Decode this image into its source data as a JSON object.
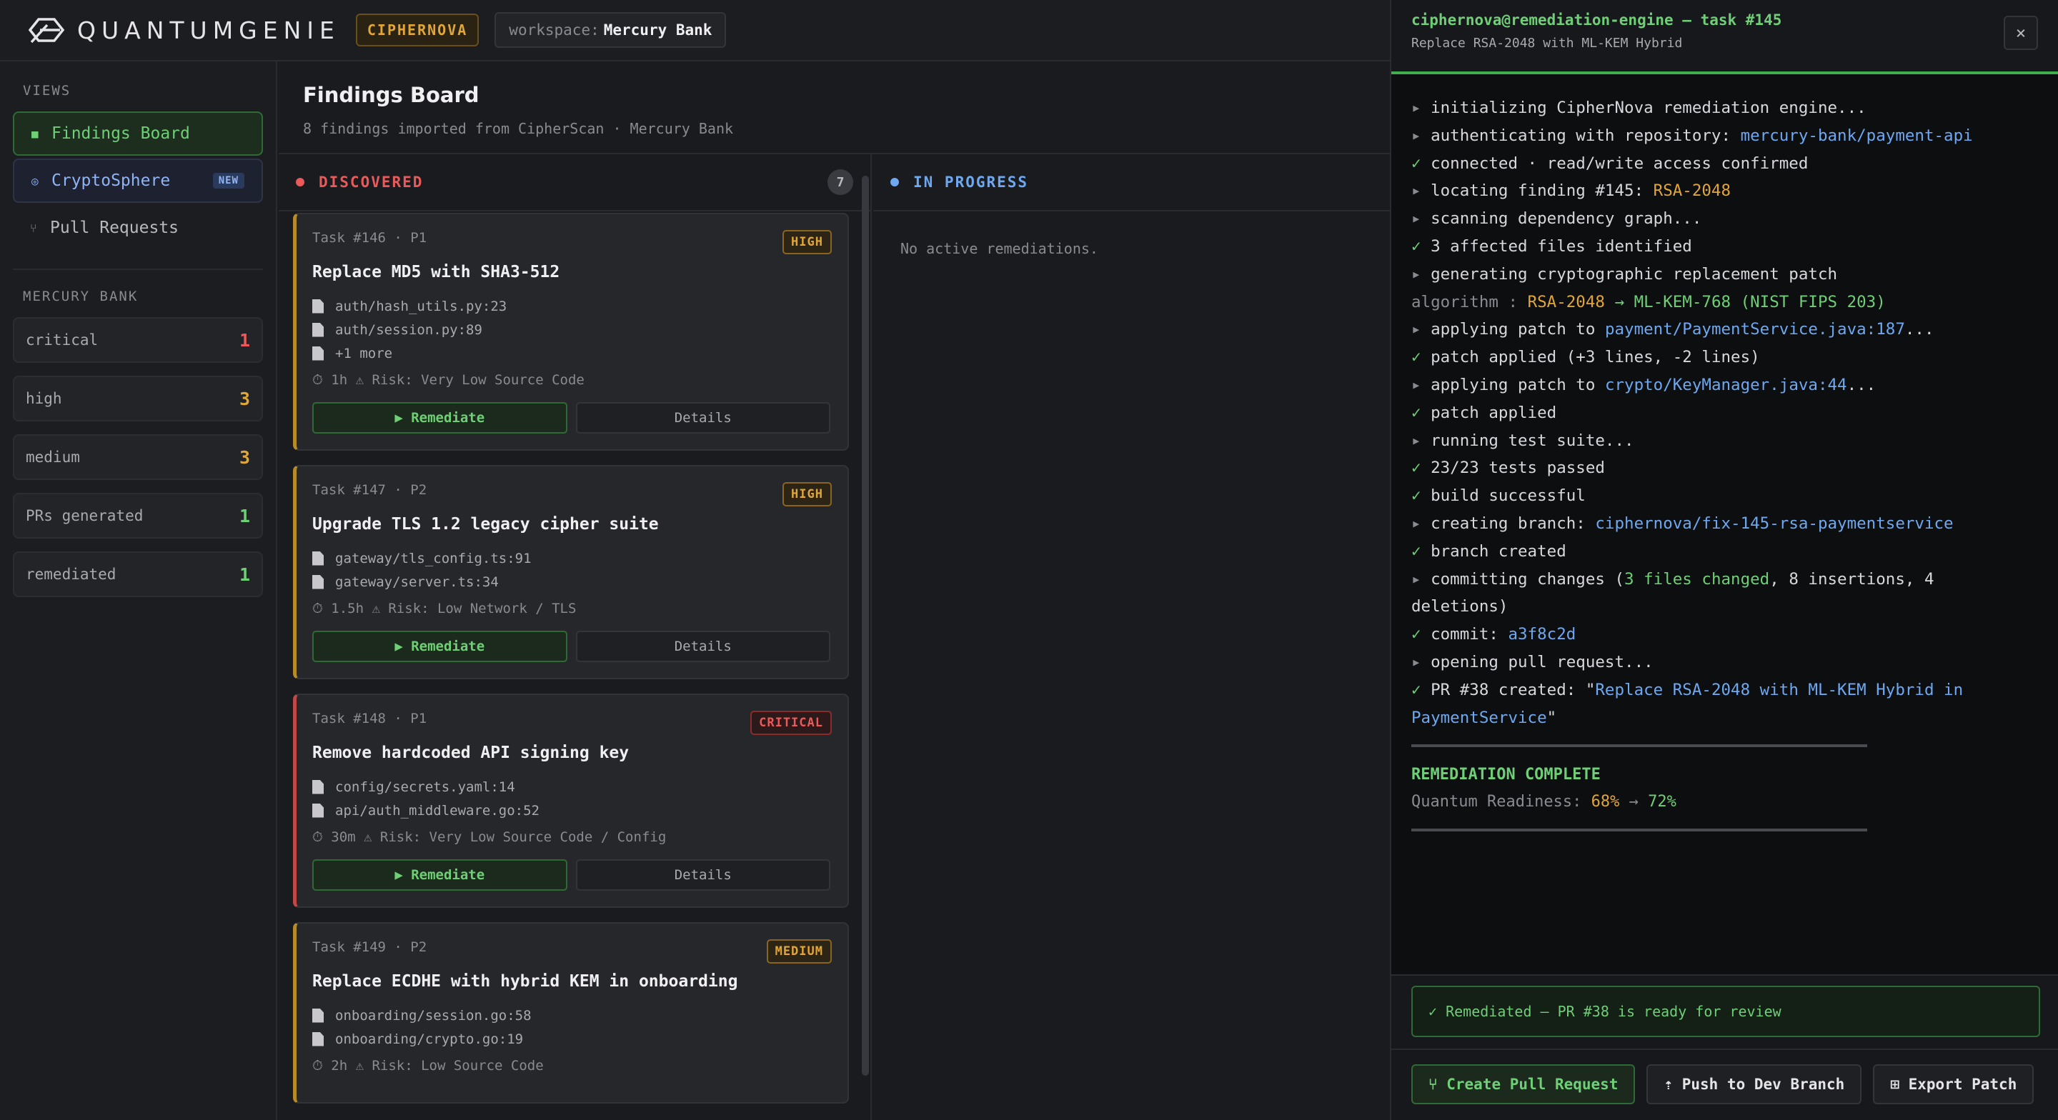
{
  "header": {
    "brand": "QUANTUMGENIE",
    "product_badge": "CIPHERNOVA",
    "workspace_label": "workspace:",
    "workspace_name": "Mercury Bank"
  },
  "sidebar": {
    "views_label": "VIEWS",
    "nav": [
      {
        "label": "Findings Board",
        "icon": "square-icon"
      },
      {
        "label": "CryptoSphere",
        "icon": "target-icon",
        "badge": "NEW"
      },
      {
        "label": "Pull Requests",
        "icon": "branch-icon"
      }
    ],
    "org_label": "MERCURY BANK",
    "stats": [
      {
        "label": "critical",
        "count": "1",
        "color": "#ea5a5a"
      },
      {
        "label": "high",
        "count": "3",
        "color": "#e0a63a"
      },
      {
        "label": "medium",
        "count": "3",
        "color": "#e0a63a"
      },
      {
        "label": "PRs generated",
        "count": "1",
        "color": "#6fcf76"
      },
      {
        "label": "remediated",
        "count": "1",
        "color": "#6fcf76"
      }
    ]
  },
  "page": {
    "title": "Findings Board",
    "subtitle": "8 findings imported from CipherScan · Mercury Bank"
  },
  "columns": {
    "discovered": {
      "label": "DISCOVERED",
      "count": "7",
      "color": "#ea5a5a"
    },
    "in_progress": {
      "label": "IN PROGRESS",
      "color": "#6ea8f0",
      "empty": "No active remediations."
    }
  },
  "cards": [
    {
      "meta": "Task #146 · P1",
      "severity": "HIGH",
      "title": "Replace MD5 with SHA3-512",
      "files": [
        "auth/hash_utils.py:23",
        "auth/session.py:89",
        "+1 more"
      ],
      "risk": "⏱ 1h  ⚠ Risk: Very Low  Source Code",
      "remediate": "▶ Remediate",
      "details": "Details"
    },
    {
      "meta": "Task #147 · P2",
      "severity": "HIGH",
      "title": "Upgrade TLS 1.2 legacy cipher suite",
      "files": [
        "gateway/tls_config.ts:91",
        "gateway/server.ts:34"
      ],
      "risk": "⏱ 1.5h  ⚠ Risk: Low  Network / TLS",
      "remediate": "▶ Remediate",
      "details": "Details"
    },
    {
      "meta": "Task #148 · P1",
      "severity": "CRITICAL",
      "title": "Remove hardcoded API signing key",
      "files": [
        "config/secrets.yaml:14",
        "api/auth_middleware.go:52"
      ],
      "risk": "⏱ 30m  ⚠ Risk: Very Low  Source Code / Config",
      "remediate": "▶ Remediate",
      "details": "Details"
    },
    {
      "meta": "Task #149 · P2",
      "severity": "MEDIUM",
      "title": "Replace ECDHE with hybrid KEM in onboarding",
      "files": [
        "onboarding/session.go:58",
        "onboarding/crypto.go:19"
      ],
      "risk": "⏱ 2h  ⚠ Risk: Low  Source Code"
    }
  ],
  "terminal": {
    "title": "ciphernova@remediation-engine — task #145",
    "subtitle": "Replace RSA-2048 with ML-KEM Hybrid",
    "close": "×",
    "lines": [
      {
        "p": "▸",
        "t": "initializing CipherNova remediation engine..."
      },
      {
        "p": "▸",
        "t": "authenticating with repository: ",
        "h": "mercury-bank/payment-api",
        "hc": "blue"
      },
      {
        "p": "✓",
        "t": "connected · read/write access confirmed"
      },
      {
        "p": "▸",
        "t": "locating finding #145: ",
        "h": "RSA-2048",
        "hc": "orange"
      },
      {
        "p": "▸",
        "t": "scanning dependency graph..."
      },
      {
        "p": "✓",
        "t": "3 affected files identified"
      },
      {
        "p": "▸",
        "t": "generating cryptographic replacement patch"
      },
      {
        "p": "",
        "t": "algorithm : ",
        "h": "RSA-2048",
        "hc": "orange",
        "h2": " → ML-KEM-768 (NIST FIPS 203)",
        "h2c": "green"
      },
      {
        "p": "▸",
        "t": "applying patch to ",
        "h": "payment/PaymentService.java:187",
        "hc": "blue",
        "tail": "..."
      },
      {
        "p": "✓",
        "t": "patch applied (+3 lines, -2 lines)"
      },
      {
        "p": "▸",
        "t": "applying patch to ",
        "h": "crypto/KeyManager.java:44",
        "hc": "blue",
        "tail": "..."
      },
      {
        "p": "✓",
        "t": "patch applied"
      },
      {
        "p": "▸",
        "t": "running test suite..."
      },
      {
        "p": "✓",
        "t": "23/23 tests passed"
      },
      {
        "p": "✓",
        "t": "build successful"
      },
      {
        "p": "▸",
        "t": "creating branch: ",
        "h": "ciphernova/fix-145-rsa-paymentservice",
        "hc": "blue"
      },
      {
        "p": "✓",
        "t": "branch created"
      },
      {
        "p": "▸",
        "t": "committing changes (",
        "h": "3 files changed",
        "hc": "green",
        "tail": ", 8 insertions, 4 deletions)"
      },
      {
        "p": "✓",
        "t": "commit: ",
        "h": "a3f8c2d",
        "hc": "blue"
      },
      {
        "p": "▸",
        "t": "opening pull request..."
      },
      {
        "p": "✓",
        "t": "PR #38 created: \"",
        "h": "Replace RSA-2048 with ML-KEM Hybrid in PaymentService",
        "hc": "blue",
        "tail": "\""
      }
    ],
    "complete": "REMEDIATION COMPLETE",
    "readiness_label": "Quantum Readiness: ",
    "readiness_from": "68%",
    "readiness_arrow": " → ",
    "readiness_to": "72%",
    "ready_message": "✓ Remediated — PR #38 is ready for review",
    "buttons": [
      "⑂ Create Pull Request",
      "⇡ Push to Dev Branch",
      "⊞ Export Patch"
    ]
  }
}
